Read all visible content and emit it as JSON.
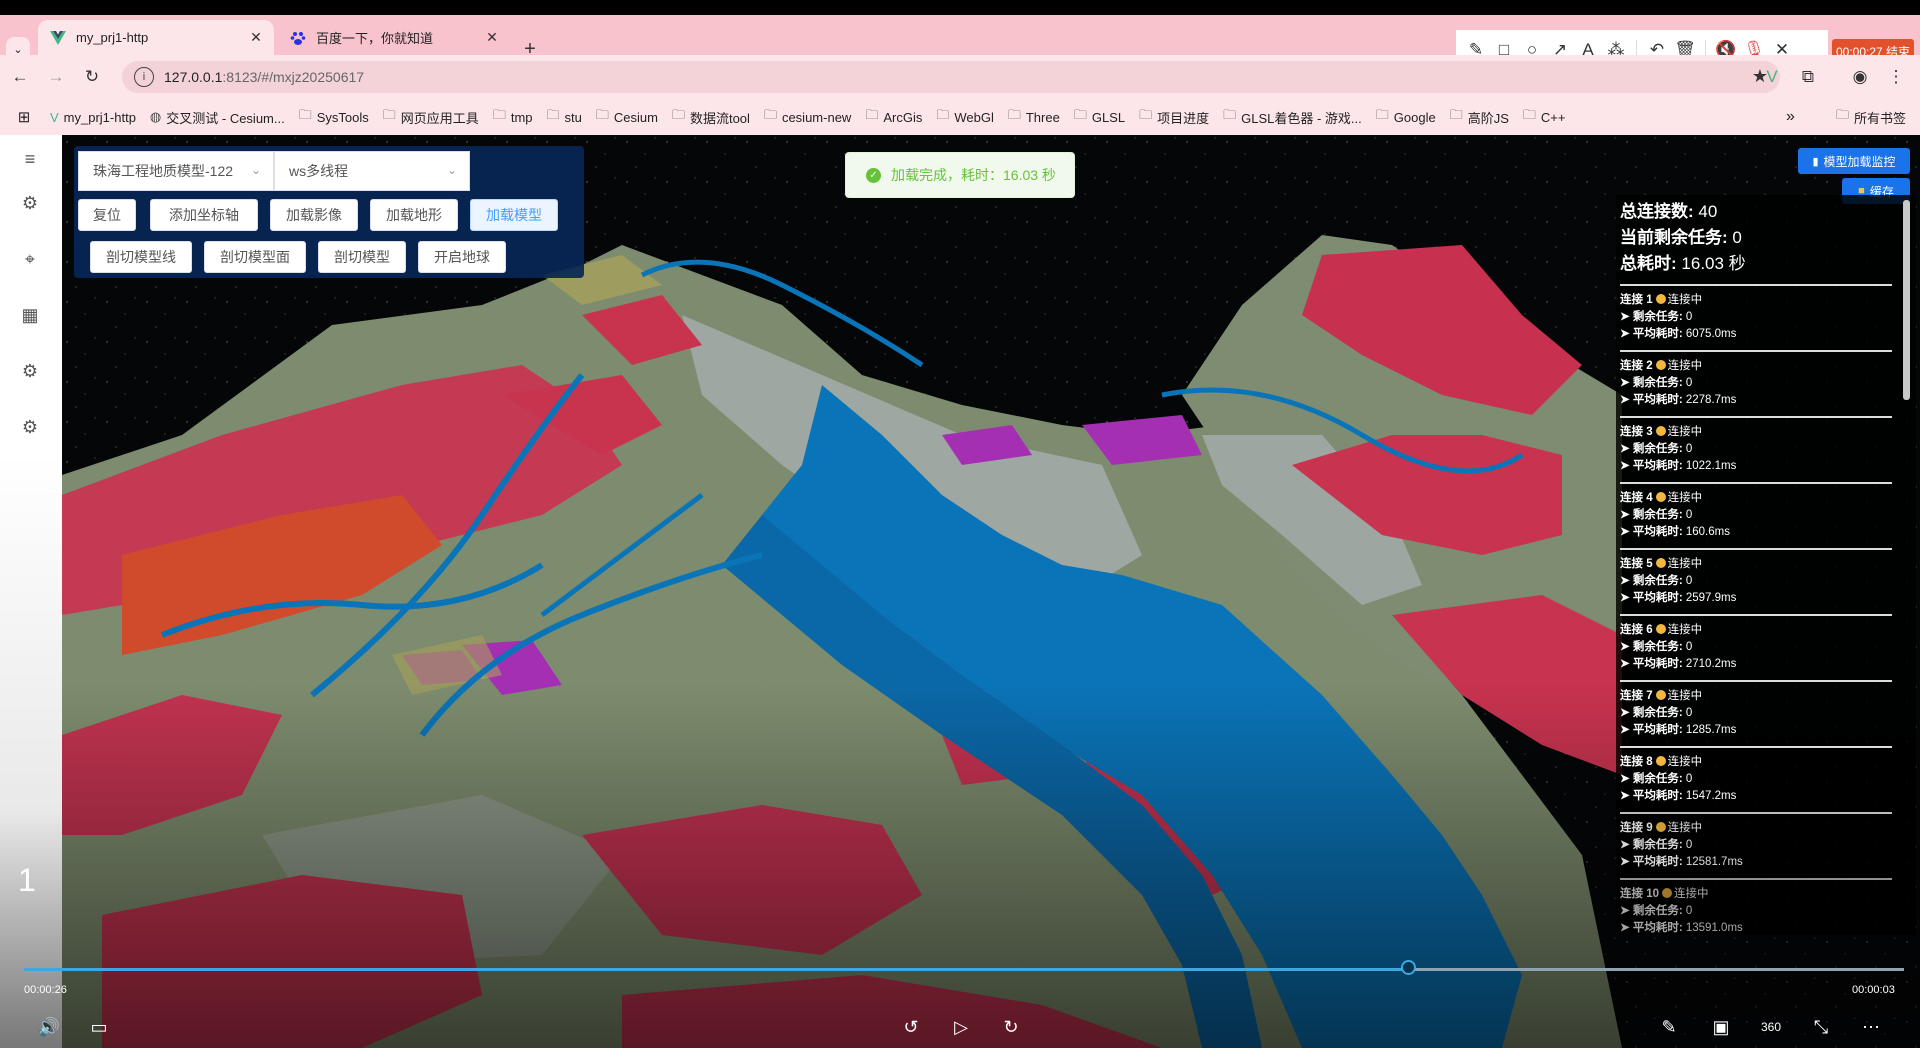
{
  "browser": {
    "tabs": [
      {
        "title": "my_prj1-http",
        "active": true,
        "icon": "vue-icon"
      },
      {
        "title": "百度一下，你就知道",
        "active": false,
        "icon": "baidu-icon"
      }
    ],
    "recording": "00:00:27 结束",
    "address": {
      "host": "127.0.0.1",
      "path": ":8123/#/mxjz20250617"
    },
    "bookmarks": [
      "my_prj1-http",
      "交叉测试 - Cesium...",
      "SysTools",
      "网页应用工具",
      "tmp",
      "stu",
      "Cesium",
      "数据流tool",
      "cesium-new",
      "ArcGis",
      "WebGl",
      "Three",
      "GLSL",
      "项目进度",
      "GLSL着色器 - 游戏...",
      "Google",
      "高阶JS",
      "C++"
    ],
    "bookmarks_more": "»",
    "all_bookmarks": "所有书签"
  },
  "toolbar": {
    "model_select": "珠海工程地质模型-122",
    "mode_select": "ws多线程",
    "row1": [
      "复位",
      "添加坐标轴",
      "加载影像",
      "加载地形",
      "加载模型"
    ],
    "row2": [
      "剖切模型线",
      "剖切模型面",
      "剖切模型",
      "开启地球"
    ],
    "active_button": "加载模型"
  },
  "toast": {
    "text": "加载完成，耗时：16.03 秒"
  },
  "top_buttons": {
    "monitor": "模型加载监控",
    "cache": "缓存"
  },
  "stats": {
    "total_label": "总连接数:",
    "total_value": "40",
    "remaining_label": "当前剩余任务:",
    "remaining_value": "0",
    "time_label": "总耗时:",
    "time_value": "16.03 秒",
    "status": "连接中",
    "remaining_task_label": "➤ 剩余任务:",
    "avg_label": "➤ 平均耗时:",
    "connections": [
      {
        "name": "连接 1",
        "remaining": "0",
        "avg": "6075.0ms"
      },
      {
        "name": "连接 2",
        "remaining": "0",
        "avg": "2278.7ms"
      },
      {
        "name": "连接 3",
        "remaining": "0",
        "avg": "1022.1ms"
      },
      {
        "name": "连接 4",
        "remaining": "0",
        "avg": "160.6ms"
      },
      {
        "name": "连接 5",
        "remaining": "0",
        "avg": "2597.9ms"
      },
      {
        "name": "连接 6",
        "remaining": "0",
        "avg": "2710.2ms"
      },
      {
        "name": "连接 7",
        "remaining": "0",
        "avg": "1285.7ms"
      },
      {
        "name": "连接 8",
        "remaining": "0",
        "avg": "1547.2ms"
      },
      {
        "name": "连接 9",
        "remaining": "0",
        "avg": "12581.7ms"
      },
      {
        "name": "连接 10",
        "remaining": "0",
        "avg": "13591.0ms"
      }
    ]
  },
  "video": {
    "page": "1",
    "elapsed": "00:00:26",
    "remaining": "00:00:03",
    "progress_fraction": 0.736
  }
}
